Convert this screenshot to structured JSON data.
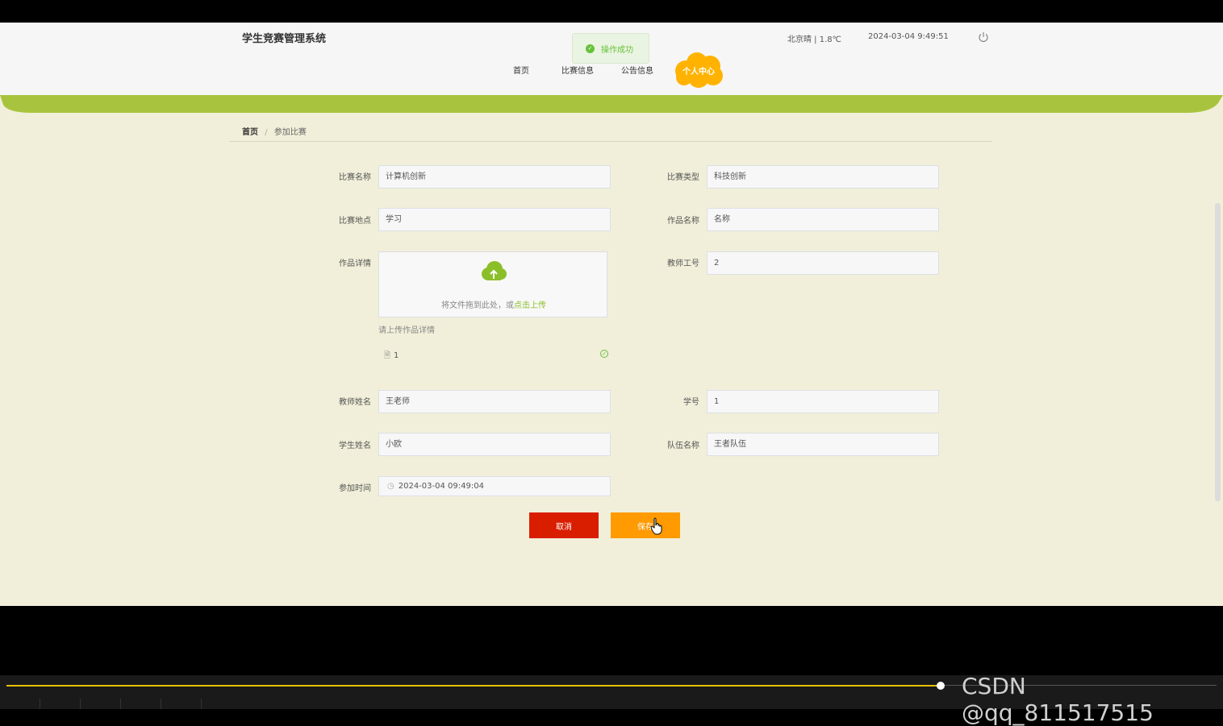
{
  "header": {
    "site_title": "学生竞赛管理系统",
    "weather": "北京晴 | 1.8℃",
    "datetime": "2024-03-04  9:49:51",
    "toast": "操作成功",
    "nav": [
      "首页",
      "比赛信息",
      "公告信息"
    ],
    "nav_personal": "个人中心"
  },
  "breadcrumb": {
    "home": "首页",
    "separator": "/",
    "current": "参加比赛"
  },
  "form": {
    "competition_name": {
      "label": "比赛名称",
      "value": "计算机创新"
    },
    "competition_type": {
      "label": "比赛类型",
      "value": "科技创新"
    },
    "competition_place": {
      "label": "比赛地点",
      "value": "学习"
    },
    "work_name": {
      "label": "作品名称",
      "value": "名称"
    },
    "work_detail": {
      "label": "作品详情"
    },
    "teacher_id": {
      "label": "教师工号",
      "value": "2"
    },
    "upload": {
      "text_prefix": "将文件拖到此处，或",
      "text_link": "点击上传",
      "tip": "请上传作品详情",
      "file_name": "1"
    },
    "teacher_name": {
      "label": "教师姓名",
      "value": "王老师"
    },
    "student_id": {
      "label": "学号",
      "value": "1"
    },
    "student_name": {
      "label": "学生姓名",
      "value": "小欧"
    },
    "team_name": {
      "label": "队伍名称",
      "value": "王者队伍"
    },
    "join_time": {
      "label": "参加时间",
      "value": "2024-03-04 09:49:04"
    }
  },
  "buttons": {
    "cancel": "取消",
    "save": "保存"
  },
  "player": {
    "watermark": "CSDN @qq_811517515",
    "progress": 0.765
  },
  "colors": {
    "accent_green": "#a8c43e",
    "accent_orange": "#ff9a00",
    "cancel_red": "#d91e00",
    "success": "#67c23a"
  }
}
